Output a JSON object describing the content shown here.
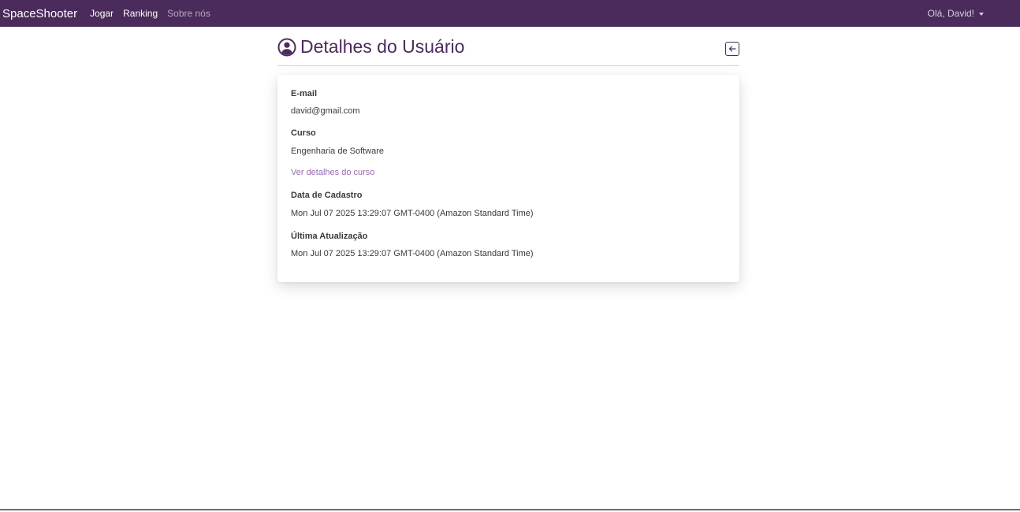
{
  "navbar": {
    "brand": "SpaceShooter",
    "links": [
      {
        "label": "Jogar"
      },
      {
        "label": "Ranking"
      },
      {
        "label": "Sobre nós"
      }
    ],
    "user_menu": "Olá, David!"
  },
  "page": {
    "title": "Detalhes do Usuário",
    "title_icon": "user-circle-icon",
    "back_icon": "arrow-left-square-icon"
  },
  "details": {
    "email_label": "E-mail",
    "email_value": "david@gmail.com",
    "course_label": "Curso",
    "course_value": "Engenharia de Software",
    "course_link": "Ver detalhes do curso",
    "created_label": "Data de Cadastro",
    "created_value": "Mon Jul 07 2025 13:29:07 GMT-0400 (Amazon Standard Time)",
    "updated_label": "Última Atualização",
    "updated_value": "Mon Jul 07 2025 13:29:07 GMT-0400 (Amazon Standard Time)"
  },
  "colors": {
    "navbar_bg": "#4b2b5b",
    "accent": "#4b2b5b",
    "link": "#9a6bb1"
  }
}
